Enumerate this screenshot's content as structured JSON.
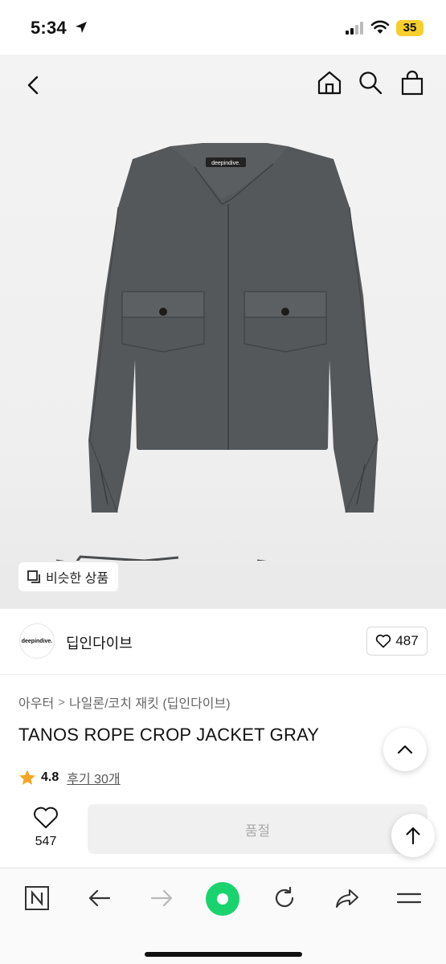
{
  "status_bar": {
    "time": "5:34",
    "battery": "35"
  },
  "nav": {
    "back": "chevron-left-icon",
    "home": "home-icon",
    "search": "search-icon",
    "bag": "shopping-bag-icon"
  },
  "hero": {
    "similar_label": "비슷한 상품",
    "jacket_logo": "deepindive."
  },
  "brand": {
    "logo_text": "deepindive.",
    "name": "딥인다이브",
    "like_count": "487"
  },
  "breadcrumb": {
    "items": [
      "아우터",
      "나일론/코치 재킷 (딥인다이브)"
    ],
    "separator": ">"
  },
  "product": {
    "title": "TANOS ROPE CROP JACKET GRAY",
    "rating": "4.8",
    "reviews": "후기 30개"
  },
  "purchase": {
    "wish_count": "547",
    "soldout_label": "품절"
  },
  "colors": {
    "accent_green": "#19d36e",
    "battery": "#f6cf2c",
    "star": "#f5a623",
    "jacket": "#55585b"
  }
}
